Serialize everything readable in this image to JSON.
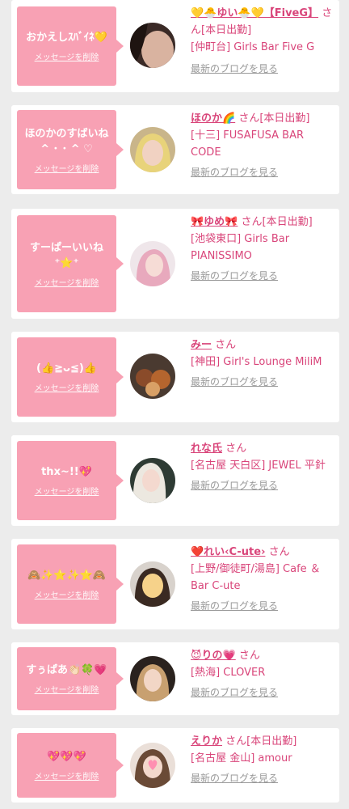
{
  "delete_label": "メッセージを削除",
  "blog_label": "最新のブログを見る",
  "colors": {
    "bubble": "#f8a1b4",
    "accent": "#d9457a",
    "muted": "#999999",
    "background": "#ececec"
  },
  "items": [
    {
      "message": "おかえしｽﾊﾞｲﾈ💛",
      "avatar_icon": "profile-photo",
      "cast_name": "💛🐣ゆい🐣💛【FiveG】",
      "san": "さん",
      "status": "[本日出勤]",
      "shop": "[仲町台] Girls Bar Five G"
    },
    {
      "message": "ほのかのすばいね\n ^ ･ ･ ^ ♡",
      "avatar_icon": "profile-photo",
      "cast_name": "ほのか🌈",
      "san": "さん",
      "status": "[本日出勤]",
      "shop": "[十三] FUSAFUSA BAR CODE"
    },
    {
      "message": "すーぱーいいね\n⁺⭐️⁺",
      "avatar_icon": "profile-photo",
      "cast_name": "🎀ゆめ🎀",
      "san": "さん",
      "status": "[本日出勤]",
      "shop": "[池袋東口] Girls Bar PIANISSIMO"
    },
    {
      "message": "(👍≧ᴗ≦)👍",
      "avatar_icon": "profile-photo",
      "cast_name": "みー",
      "san": "さん",
      "status": "",
      "shop": "[神田] Girl's Lounge MiliM"
    },
    {
      "message": "thx~!!💖",
      "avatar_icon": "profile-photo",
      "cast_name": "れな氏",
      "san": "さん",
      "status": "",
      "shop": "[名古屋 天白区] JEWEL 平針"
    },
    {
      "message": "🙈✨⭐️✨⭐️🙈",
      "avatar_icon": "profile-photo",
      "cast_name": "❤️れい‹C-ute›",
      "san": "さん",
      "status": "",
      "shop": "[上野/御徒町/湯島] Cafe ＆Bar C-ute"
    },
    {
      "message": "すぅぱあ👏🏻🍀💗",
      "avatar_icon": "profile-photo",
      "cast_name": "😈りの💗",
      "san": "さん",
      "status": "",
      "shop": "[熱海] CLOVER"
    },
    {
      "message": "💖💖💖",
      "avatar_icon": "profile-photo",
      "cast_name": "えりか",
      "san": "さん",
      "status": "[本日出勤]",
      "shop": "[名古屋 金山] amour"
    }
  ]
}
